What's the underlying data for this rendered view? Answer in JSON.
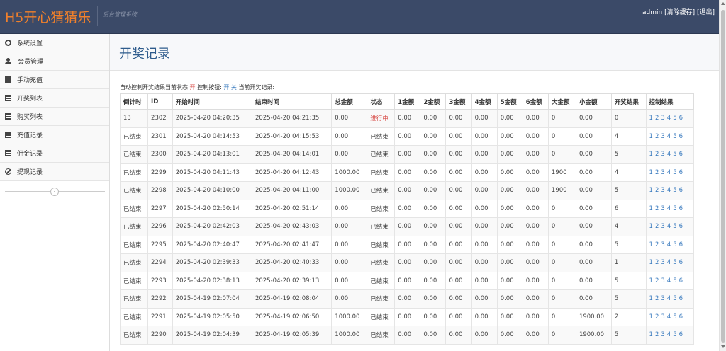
{
  "header": {
    "logo": "H5开心猜猜乐",
    "subtitle": "后台管理系统",
    "user": "admin",
    "clear_cache": "[清除缓存]",
    "logout": "[退出]"
  },
  "sidebar": {
    "items": [
      {
        "label": "系统设置",
        "icon": "gear-icon"
      },
      {
        "label": "会员管理",
        "icon": "user-icon"
      },
      {
        "label": "手动充值",
        "icon": "table-icon"
      },
      {
        "label": "开奖列表",
        "icon": "table-icon"
      },
      {
        "label": "购买列表",
        "icon": "table-icon"
      },
      {
        "label": "充值记录",
        "icon": "table-icon"
      },
      {
        "label": "佣金记录",
        "icon": "table-icon"
      },
      {
        "label": "提现记录",
        "icon": "ban-icon"
      }
    ],
    "collapse_glyph": "‹"
  },
  "page": {
    "title": "开奖记录",
    "status_prefix": "自动控制开奖结果当前状态",
    "status_value": "开",
    "control_label": "控制按钮:",
    "btn_on": "开",
    "btn_off": "关",
    "current_label": "当前开奖记录:"
  },
  "table": {
    "headers": [
      "倒计时",
      "ID",
      "开始时间",
      "结束时间",
      "总金额",
      "状态",
      "1金额",
      "2金额",
      "3金额",
      "4金额",
      "5金额",
      "6金额",
      "大金额",
      "小金额",
      "开奖结果",
      "控制结果"
    ],
    "control_links": [
      "1",
      "2",
      "3",
      "4",
      "5",
      "6"
    ],
    "rows": [
      [
        "13",
        "2302",
        "2025-04-20 04:20:35",
        "2025-04-20 04:21:35",
        "0.00",
        "进行中",
        "0.00",
        "0.00",
        "0.00",
        "0.00",
        "0.00",
        "0.00",
        "0",
        "0.00",
        "0"
      ],
      [
        "已结束",
        "2301",
        "2025-04-20 04:14:53",
        "2025-04-20 04:15:53",
        "0.00",
        "已结束",
        "0.00",
        "0.00",
        "0.00",
        "0.00",
        "0.00",
        "0.00",
        "0",
        "0.00",
        "4"
      ],
      [
        "已结束",
        "2300",
        "2025-04-20 04:13:01",
        "2025-04-20 04:14:01",
        "0.00",
        "已结束",
        "0.00",
        "0.00",
        "0.00",
        "0.00",
        "0.00",
        "0.00",
        "0",
        "0.00",
        "5"
      ],
      [
        "已结束",
        "2299",
        "2025-04-20 04:11:43",
        "2025-04-20 04:12:43",
        "1000.00",
        "已结束",
        "0.00",
        "0.00",
        "0.00",
        "0.00",
        "0.00",
        "0.00",
        "1900",
        "0.00",
        "4"
      ],
      [
        "已结束",
        "2298",
        "2025-04-20 04:10:00",
        "2025-04-20 04:11:00",
        "1000.00",
        "已结束",
        "0.00",
        "0.00",
        "0.00",
        "0.00",
        "0.00",
        "0.00",
        "1900",
        "0.00",
        "5"
      ],
      [
        "已结束",
        "2297",
        "2025-04-20 02:50:14",
        "2025-04-20 02:51:14",
        "0.00",
        "已结束",
        "0.00",
        "0.00",
        "0.00",
        "0.00",
        "0.00",
        "0.00",
        "0",
        "0.00",
        "6"
      ],
      [
        "已结束",
        "2296",
        "2025-04-20 02:42:03",
        "2025-04-20 02:43:03",
        "0.00",
        "已结束",
        "0.00",
        "0.00",
        "0.00",
        "0.00",
        "0.00",
        "0.00",
        "0",
        "0.00",
        "4"
      ],
      [
        "已结束",
        "2295",
        "2025-04-20 02:40:47",
        "2025-04-20 02:41:47",
        "0.00",
        "已结束",
        "0.00",
        "0.00",
        "0.00",
        "0.00",
        "0.00",
        "0.00",
        "0",
        "0.00",
        "5"
      ],
      [
        "已结束",
        "2294",
        "2025-04-20 02:39:33",
        "2025-04-20 02:40:33",
        "0.00",
        "已结束",
        "0.00",
        "0.00",
        "0.00",
        "0.00",
        "0.00",
        "0.00",
        "0",
        "0.00",
        "1"
      ],
      [
        "已结束",
        "2293",
        "2025-04-20 02:38:13",
        "2025-04-20 02:39:13",
        "0.00",
        "已结束",
        "0.00",
        "0.00",
        "0.00",
        "0.00",
        "0.00",
        "0.00",
        "0",
        "0.00",
        "5"
      ],
      [
        "已结束",
        "2292",
        "2025-04-19 02:07:04",
        "2025-04-19 02:08:04",
        "0.00",
        "已结束",
        "0.00",
        "0.00",
        "0.00",
        "0.00",
        "0.00",
        "0.00",
        "0",
        "0.00",
        "5"
      ],
      [
        "已结束",
        "2291",
        "2025-04-19 02:05:50",
        "2025-04-19 02:06:50",
        "1000.00",
        "已结束",
        "0.00",
        "0.00",
        "0.00",
        "0.00",
        "0.00",
        "0.00",
        "0",
        "1900.00",
        "2"
      ],
      [
        "已结束",
        "2290",
        "2025-04-19 02:04:39",
        "2025-04-19 02:05:39",
        "1000.00",
        "已结束",
        "0.00",
        "0.00",
        "0.00",
        "0.00",
        "0.00",
        "0.00",
        "0",
        "1900.00",
        "5"
      ]
    ]
  }
}
